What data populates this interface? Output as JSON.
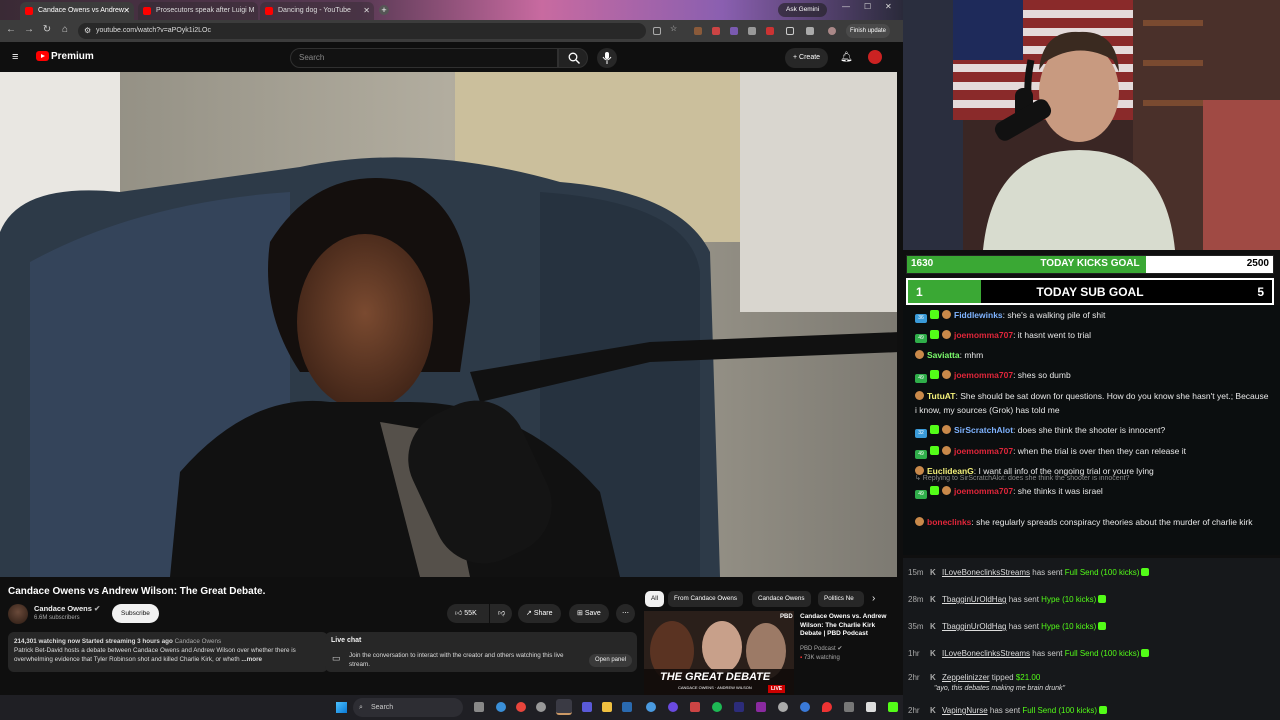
{
  "browser": {
    "tabs": [
      {
        "title": "Candace Owens vs Andrew"
      },
      {
        "title": "Prosecutors speak after Luigi M"
      },
      {
        "title": "Dancing dog - YouTube"
      }
    ],
    "ask_gemini": "Ask Gemini",
    "url": "youtube.com/watch?v=aPOyk1i2LOc",
    "finish_update": "Finish update"
  },
  "youtube": {
    "logo": "Premium",
    "search_placeholder": "Search",
    "create_label": "Create",
    "video_title": "Candace Owens vs Andrew Wilson: The Great Debate.",
    "channel_name": "Candace Owens",
    "subscribers": "6.6M subscribers",
    "subscribe_label": "Subscribe",
    "likes": "55K",
    "share_label": "Share",
    "save_label": "Save",
    "desc_stats": "214,301 watching now  Started streaming 3 hours ago",
    "desc_channel": "Candace Owens",
    "desc_text": "Patrick Bet-David hosts a debate between Candace Owens and Andrew Wilson over whether there is overwhelming evidence that Tyler Robinson shot and killed Charlie Kirk, or wheth",
    "desc_more": "...more",
    "live_chat_title": "Live chat",
    "live_chat_text": "Join the conversation to interact with the creator and others watching this live stream.",
    "open_panel": "Open panel",
    "chips": [
      "All",
      "From Candace Owens",
      "Candace Owens",
      "Politics Ne"
    ],
    "rec_title": "Candace Owens vs. Andrew Wilson: The Charlie Kirk Debate | PBD Podcast",
    "rec_channel": "PBD Podcast",
    "rec_watching": "73K watching",
    "rec_thumb_text": "THE GREAT DEBATE",
    "rec_thumb_names": "CANDACE OWENS · ANDREW WILSON",
    "rec_pbd": "PBD",
    "rec_live": "LIVE"
  },
  "taskbar": {
    "search": "Search"
  },
  "goals": {
    "kicks_current": "1630",
    "kicks_label": "TODAY KICKS GOAL",
    "kicks_target": "2500",
    "kicks_progress": 0.652,
    "sub_current": "1",
    "sub_label": "TODAY SUB GOAL",
    "sub_target": "5",
    "sub_progress": 0.2
  },
  "chat": [
    {
      "badge": "36",
      "user": "Fiddlewinks",
      "color": "#7fb3ff",
      "text": "she's a walking pile of shit"
    },
    {
      "badge": "49",
      "user": "joemomma707",
      "color": "#e0263a",
      "text": "it hasnt went to trial"
    },
    {
      "badge": "",
      "user": "Saviatta",
      "color": "#7cfc6c",
      "text": "mhm"
    },
    {
      "badge": "49",
      "user": "joemomma707",
      "color": "#e0263a",
      "text": "shes so dumb"
    },
    {
      "badge": "",
      "user": "TutuAT",
      "color": "#f5f27a",
      "text": "She should be sat down for questions. How do you know she hasn't yet.; Because i know, my sources (Grok) has told me"
    },
    {
      "badge": "32",
      "user": "SirScratchAlot",
      "color": "#7fb3ff",
      "text": "does she think the shooter is innocent?"
    },
    {
      "badge": "49",
      "user": "joemomma707",
      "color": "#e0263a",
      "text": "when the trial is over then they can release it"
    },
    {
      "badge": "",
      "user": "EuclideanG",
      "color": "#f5f27a",
      "text": "I want all info of the ongoing trial or youre lying"
    },
    {
      "badge": "49",
      "user": "joemomma707",
      "color": "#e0263a",
      "text": "she thinks it was israel",
      "reply": "Replying to SirScratchAlot: does she think the shooter is innocent?"
    },
    {
      "badge": "",
      "user": "boneclinks",
      "color": "#e0263a",
      "text": "she regularly spreads conspiracy theories about the murder of charlie kirk"
    }
  ],
  "events": [
    {
      "time": "15m",
      "user": "ILoveBoneclinksStreams",
      "verb": "has sent",
      "gift": "Full Send (100 kicks)"
    },
    {
      "time": "28m",
      "user": "TbagginUrOldHag",
      "verb": "has sent",
      "gift": "Hype (10 kicks)"
    },
    {
      "time": "35m",
      "user": "TbagginUrOldHag",
      "verb": "has sent",
      "gift": "Hype (10 kicks)"
    },
    {
      "time": "1hr",
      "user": "ILoveBoneclinksStreams",
      "verb": "has sent",
      "gift": "Full Send (100 kicks)"
    },
    {
      "time": "2hr",
      "user": "Zeppelinizzer",
      "verb": "tipped",
      "gift": "$21.00",
      "note": "\"ayo, this debates making me brain drunk\""
    },
    {
      "time": "2hr",
      "user": "VapingNurse",
      "verb": "has sent",
      "gift": "Full Send (100 kicks)"
    }
  ]
}
